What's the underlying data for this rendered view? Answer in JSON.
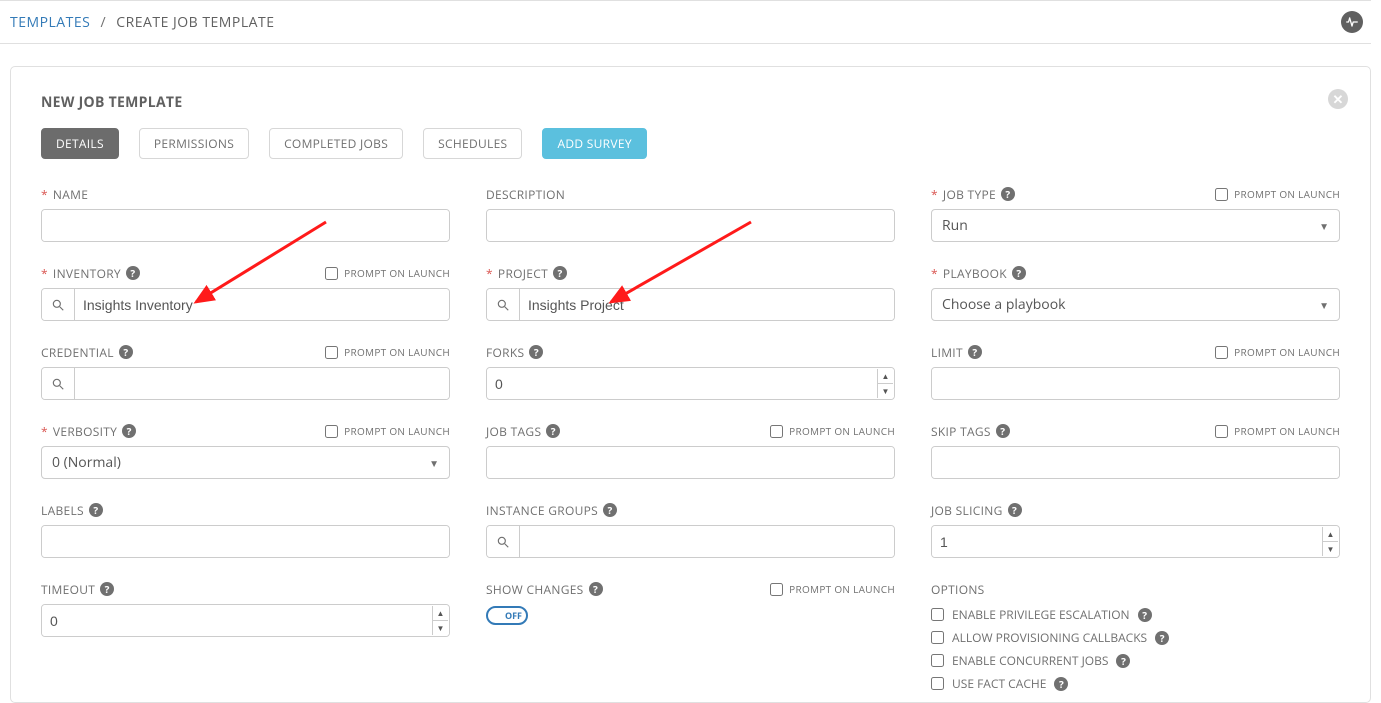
{
  "breadcrumb": {
    "root": "TEMPLATES",
    "sep": "/",
    "current": "CREATE JOB TEMPLATE"
  },
  "panel": {
    "title": "NEW JOB TEMPLATE"
  },
  "tabs": {
    "details": "DETAILS",
    "permissions": "PERMISSIONS",
    "completed_jobs": "COMPLETED JOBS",
    "schedules": "SCHEDULES",
    "add_survey": "ADD SURVEY"
  },
  "labels": {
    "name": "NAME",
    "description": "DESCRIPTION",
    "job_type": "JOB TYPE",
    "inventory": "INVENTORY",
    "project": "PROJECT",
    "playbook": "PLAYBOOK",
    "credential": "CREDENTIAL",
    "forks": "FORKS",
    "limit": "LIMIT",
    "verbosity": "VERBOSITY",
    "job_tags": "JOB TAGS",
    "skip_tags": "SKIP TAGS",
    "labels_field": "LABELS",
    "instance_groups": "INSTANCE GROUPS",
    "job_slicing": "JOB SLICING",
    "timeout": "TIMEOUT",
    "show_changes": "SHOW CHANGES",
    "options": "OPTIONS",
    "prompt": "PROMPT ON LAUNCH"
  },
  "values": {
    "job_type": "Run",
    "inventory": "Insights Inventory",
    "project": "Insights Project",
    "playbook": "Choose a playbook",
    "forks": "0",
    "verbosity": "0 (Normal)",
    "job_slicing": "1",
    "timeout": "0",
    "show_changes_toggle": "OFF"
  },
  "options": {
    "priv_escalation": "ENABLE PRIVILEGE ESCALATION",
    "prov_callbacks": "ALLOW PROVISIONING CALLBACKS",
    "concurrent": "ENABLE CONCURRENT JOBS",
    "fact_cache": "USE FACT CACHE"
  }
}
